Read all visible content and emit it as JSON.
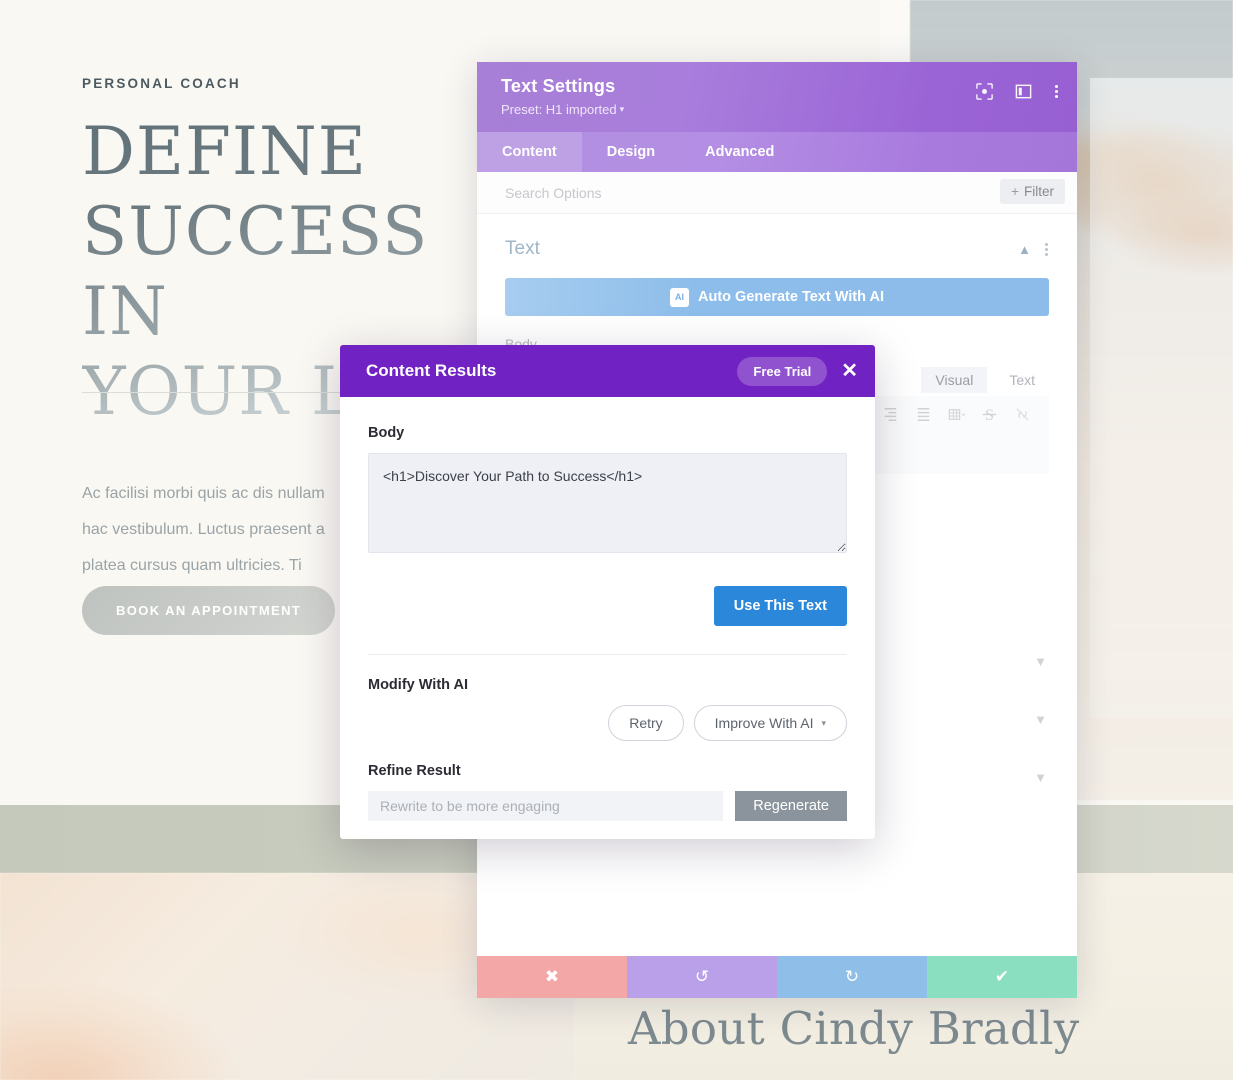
{
  "website": {
    "eyebrow": "PERSONAL COACH",
    "headline": "DEFINE\nSUCCESS IN\nYOUR LIFE",
    "paragraph": "Ac facilisi morbi quis ac dis nullam\nhac vestibulum. Luctus praesent a\nplatea cursus quam ultricies. Ti",
    "cta_label": "BOOK AN APPOINTMENT",
    "watermark": "Life",
    "about_title": "About Cindy Bradly"
  },
  "settings_panel": {
    "title": "Text Settings",
    "preset": "Preset: H1 imported",
    "preset_caret": "▾",
    "header_icons": [
      "responsive-view-icon",
      "layout-toggle-icon",
      "more-options-icon"
    ],
    "tabs": [
      {
        "label": "Content",
        "active": true
      },
      {
        "label": "Design",
        "active": false
      },
      {
        "label": "Advanced",
        "active": false
      }
    ],
    "search_placeholder": "Search Options",
    "filter_label": "Filter",
    "filter_plus": "+",
    "section": {
      "title": "Text",
      "ai_button_label": "Auto Generate Text With AI",
      "ai_badge_text": "AI",
      "body_label": "Body"
    },
    "editor": {
      "tabs": [
        {
          "label": "Visual",
          "active": true
        },
        {
          "label": "Text",
          "active": false
        }
      ],
      "toolbar_icons": [
        "align-right-icon",
        "align-justify-icon",
        "table-icon",
        "strikethrough-icon",
        "unlink-icon"
      ]
    },
    "footer_buttons": [
      {
        "name": "cancel",
        "glyph": "✖"
      },
      {
        "name": "undo",
        "glyph": "↺"
      },
      {
        "name": "redo",
        "glyph": "↻"
      },
      {
        "name": "save",
        "glyph": "✔"
      }
    ]
  },
  "content_results": {
    "title": "Content Results",
    "trial_badge": "Free Trial",
    "close_glyph": "✕",
    "body_label": "Body",
    "body_value": "<h1>Discover Your Path to Success</h1>",
    "use_this_text_label": "Use This Text",
    "modify_heading": "Modify With AI",
    "retry_label": "Retry",
    "improve_label": "Improve With AI",
    "improve_caret": "▾",
    "refine_heading": "Refine Result",
    "refine_placeholder": "Rewrite to be more engaging",
    "refine_value": "",
    "regenerate_label": "Regenerate"
  },
  "colors": {
    "modal_header": "#7122c2",
    "panel_header_purple": "#a77fd6",
    "primary_button_blue": "#2b87da",
    "ai_button_blue": "#8dbdea",
    "footer_cancel": "#f4a7a7",
    "footer_undo": "#b9a0e8",
    "footer_redo": "#8fbfe8",
    "footer_save": "#8adfc0"
  }
}
